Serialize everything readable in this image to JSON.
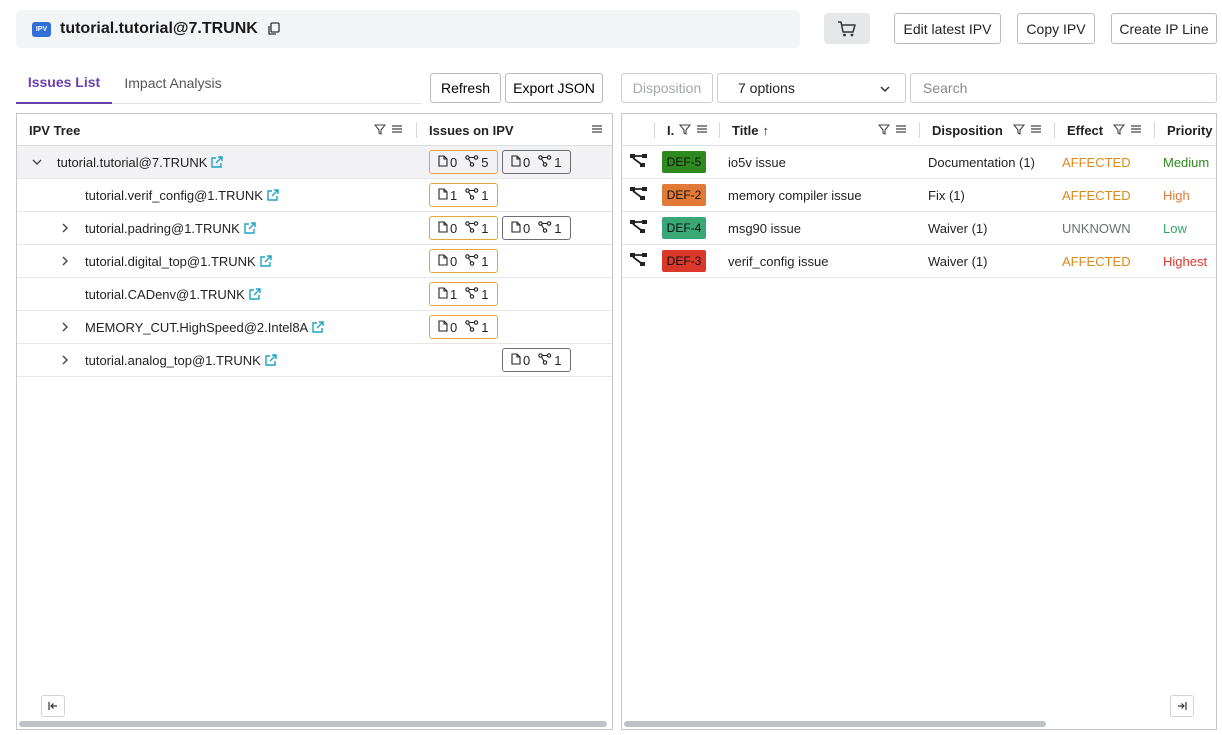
{
  "header": {
    "badge": "IPV",
    "title": "tutorial.tutorial@7.TRUNK",
    "buttons": {
      "edit": "Edit latest IPV",
      "copy": "Copy IPV",
      "create": "Create IP Line"
    }
  },
  "tabs": [
    {
      "label": "Issues List",
      "active": true
    },
    {
      "label": "Impact Analysis",
      "active": false
    }
  ],
  "toolbar": {
    "refresh": "Refresh",
    "export": "Export JSON",
    "disposition": "Disposition",
    "options": "7 options",
    "search_placeholder": "Search"
  },
  "left_table": {
    "col_tree": "IPV Tree",
    "col_issues": "Issues on IPV",
    "rows": [
      {
        "name": "tutorial.tutorial@7.TRUNK",
        "expand": "expanded",
        "b1": [
          "0",
          "5"
        ],
        "b2": [
          "0",
          "1"
        ]
      },
      {
        "name": "tutorial.verif_config@1.TRUNK",
        "expand": "none",
        "b1": [
          "1",
          "1"
        ],
        "b2": null
      },
      {
        "name": "tutorial.padring@1.TRUNK",
        "expand": "collapsed",
        "b1": [
          "0",
          "1"
        ],
        "b2": [
          "0",
          "1"
        ]
      },
      {
        "name": "tutorial.digital_top@1.TRUNK",
        "expand": "collapsed",
        "b1": [
          "0",
          "1"
        ],
        "b2": null
      },
      {
        "name": "tutorial.CADenv@1.TRUNK",
        "expand": "none",
        "b1": [
          "1",
          "1"
        ],
        "b2": null
      },
      {
        "name": "MEMORY_CUT.HighSpeed@2.Intel8A",
        "expand": "collapsed",
        "b1": [
          "0",
          "1"
        ],
        "b2": null
      },
      {
        "name": "tutorial.analog_top@1.TRUNK",
        "expand": "collapsed",
        "b1": null,
        "b2": [
          "0",
          "1"
        ]
      }
    ]
  },
  "right_table": {
    "columns": {
      "id": "I.",
      "title": "Title",
      "title_sort": "↑",
      "disposition": "Disposition",
      "effect": "Effect",
      "priority": "Priority"
    },
    "rows": [
      {
        "id": "DEF-5",
        "id_color": "#2e8a1e",
        "id_text_color": "#111111",
        "title": "io5v issue",
        "disposition": "Documentation (1)",
        "effect": "AFFECTED",
        "priority": "Medium",
        "priority_color": "#2e8a1e"
      },
      {
        "id": "DEF-2",
        "id_color": "#e07a36",
        "id_text_color": "#111111",
        "title": "memory compiler issue",
        "disposition": "Fix (1)",
        "effect": "AFFECTED",
        "priority": "High",
        "priority_color": "#e07a36"
      },
      {
        "id": "DEF-4",
        "id_color": "#3aa876",
        "id_text_color": "#111111",
        "title": "msg90 issue",
        "disposition": "Waiver (1)",
        "effect": "UNKNOWN",
        "priority": "Low",
        "priority_color": "#2fa868"
      },
      {
        "id": "DEF-3",
        "id_color": "#d9382b",
        "id_text_color": "#111111",
        "title": "verif_config issue",
        "disposition": "Waiver (1)",
        "effect": "AFFECTED",
        "priority": "Highest",
        "priority_color": "#d9382b"
      }
    ]
  },
  "icons": {
    "doc": "document-icon",
    "link": "branch-icon",
    "external": "external-link-icon",
    "cart": "cart-icon",
    "workflow": "workflow-icon"
  }
}
